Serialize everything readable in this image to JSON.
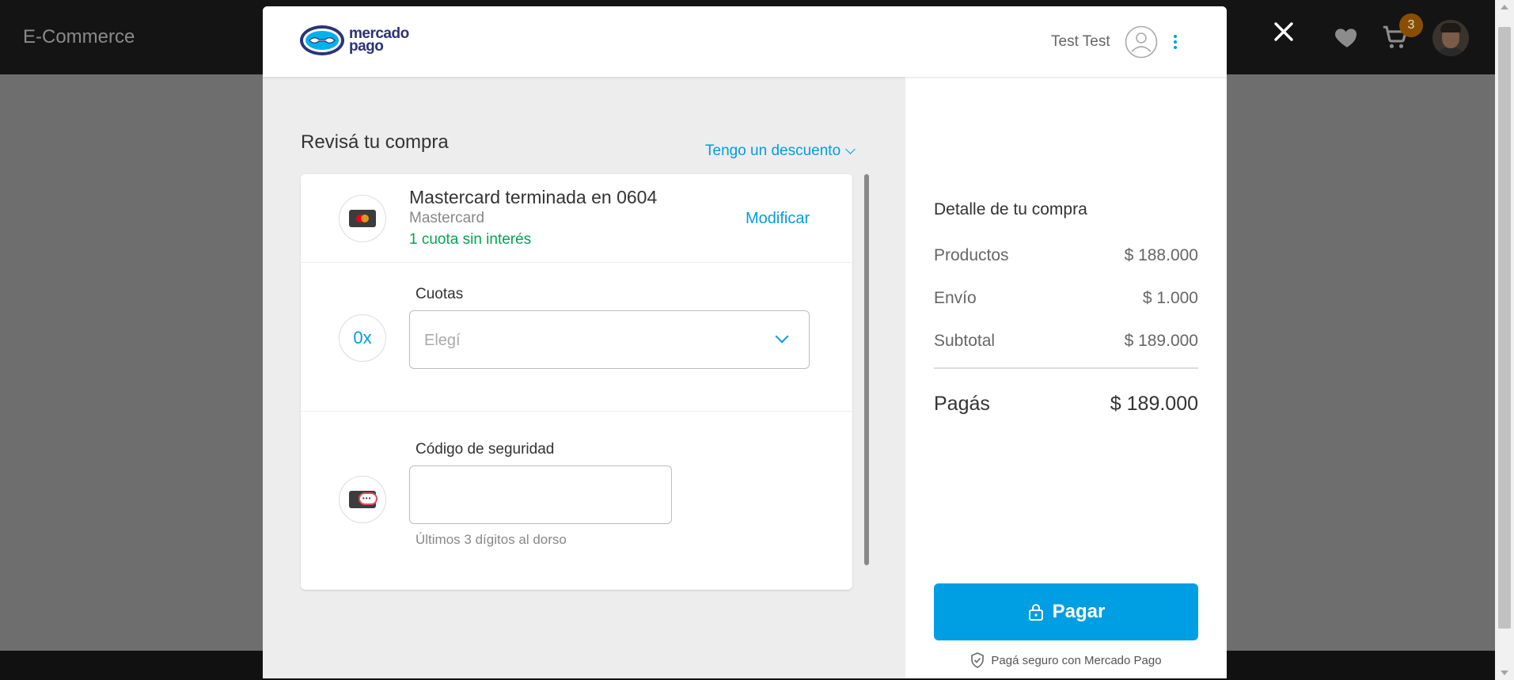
{
  "background": {
    "brand": "E-Commerce",
    "cart_count": "3"
  },
  "checkout": {
    "logo_line1": "mercado",
    "logo_line2": "pago",
    "user_name": "Test Test",
    "review_title": "Revisá tu compra",
    "discount_link": "Tengo un descuento",
    "card": {
      "title": "Mastercard terminada en 0604",
      "brand": "Mastercard",
      "installments": "1 cuota sin interés",
      "modify_label": "Modificar"
    },
    "cuotas": {
      "badge": "0x",
      "label": "Cuotas",
      "placeholder": "Elegí"
    },
    "security": {
      "label": "Código de seguridad",
      "value": "",
      "hint": "Últimos 3 dígitos al dorso"
    },
    "summary": {
      "title": "Detalle de tu compra",
      "rows": [
        {
          "label": "Productos",
          "value": "$ 188.000"
        },
        {
          "label": "Envío",
          "value": "$ 1.000"
        },
        {
          "label": "Subtotal",
          "value": "$ 189.000"
        }
      ],
      "total_label": "Pagás",
      "total_value": "$ 189.000",
      "pay_label": "Pagar",
      "secure_note": "Pagá seguro con Mercado Pago"
    }
  },
  "colors": {
    "accent": "#009ee3",
    "success": "#00a650",
    "brand_navy": "#2d3277"
  }
}
